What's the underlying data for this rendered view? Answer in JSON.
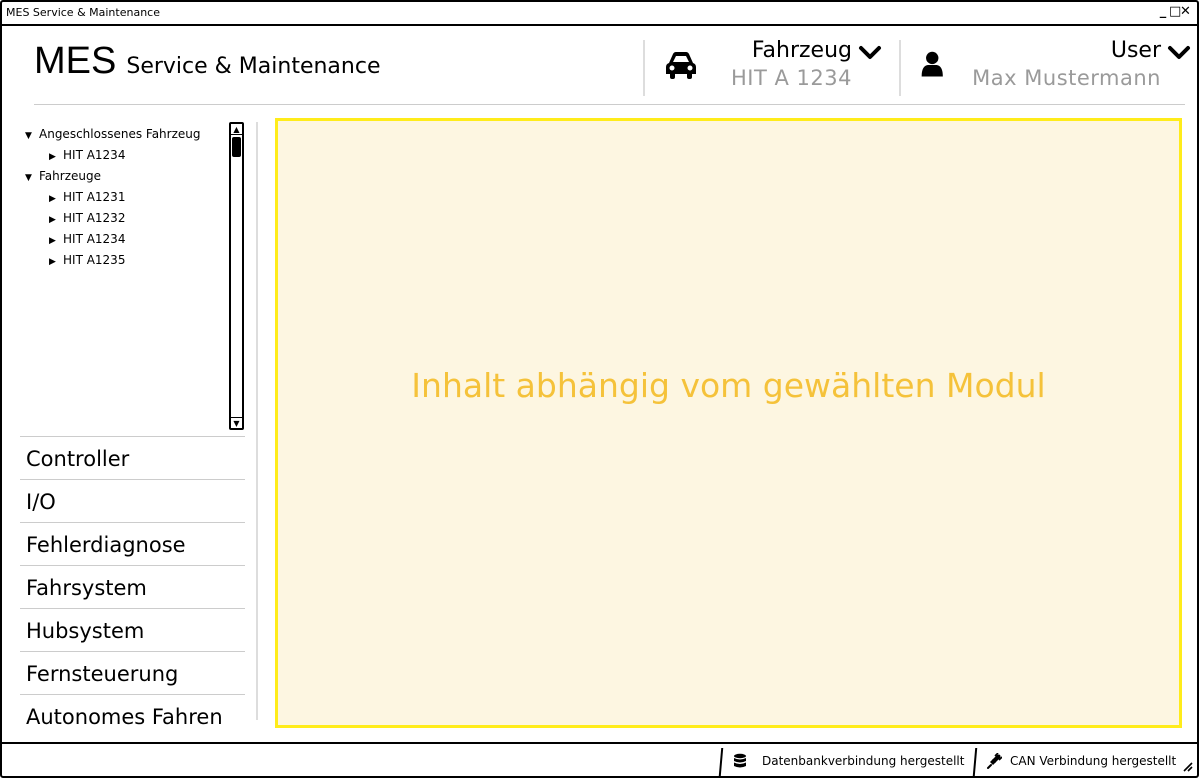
{
  "window": {
    "title": "MES Service & Maintenance",
    "controls": [
      "_",
      "□",
      "✕"
    ]
  },
  "header": {
    "logo_main": "MES",
    "logo_sub": "Service & Maintenance",
    "vehicle": {
      "label": "Fahrzeug",
      "value": "HIT A 1234",
      "icon": "car-icon"
    },
    "user": {
      "label": "User",
      "value": "Max Mustermann",
      "icon": "user-icon"
    }
  },
  "tree": {
    "items": [
      {
        "label": "Angeschlossenes Fahrzeug",
        "expanded": true,
        "level": 0
      },
      {
        "label": "HIT A1234",
        "expanded": false,
        "level": 1
      },
      {
        "label": "Fahrzeuge",
        "expanded": true,
        "level": 0
      },
      {
        "label": "HIT A1231",
        "expanded": false,
        "level": 1
      },
      {
        "label": "HIT A1232",
        "expanded": false,
        "level": 1
      },
      {
        "label": "HIT A1234",
        "expanded": false,
        "level": 1
      },
      {
        "label": "HIT A1235",
        "expanded": false,
        "level": 1
      }
    ]
  },
  "nav": {
    "items": [
      {
        "label": "Controller"
      },
      {
        "label": "I/O"
      },
      {
        "label": "Fehlerdiagnose"
      },
      {
        "label": "Fahrsystem"
      },
      {
        "label": "Hubsystem"
      },
      {
        "label": "Fernsteuerung"
      },
      {
        "label": "Autonomes Fahren"
      }
    ]
  },
  "content": {
    "placeholder": "Inhalt abhängig vom gewählten Modul"
  },
  "status": {
    "db": {
      "label": "Datenbankverbindung hergestellt",
      "icon": "database-icon"
    },
    "can": {
      "label": "CAN Verbindung hergestellt",
      "icon": "plug-icon"
    }
  },
  "colors": {
    "content_bg": "#fdf6e1",
    "content_border": "#ffec1a",
    "placeholder_text": "#f5c23a",
    "muted_text": "#9a9a9a"
  }
}
